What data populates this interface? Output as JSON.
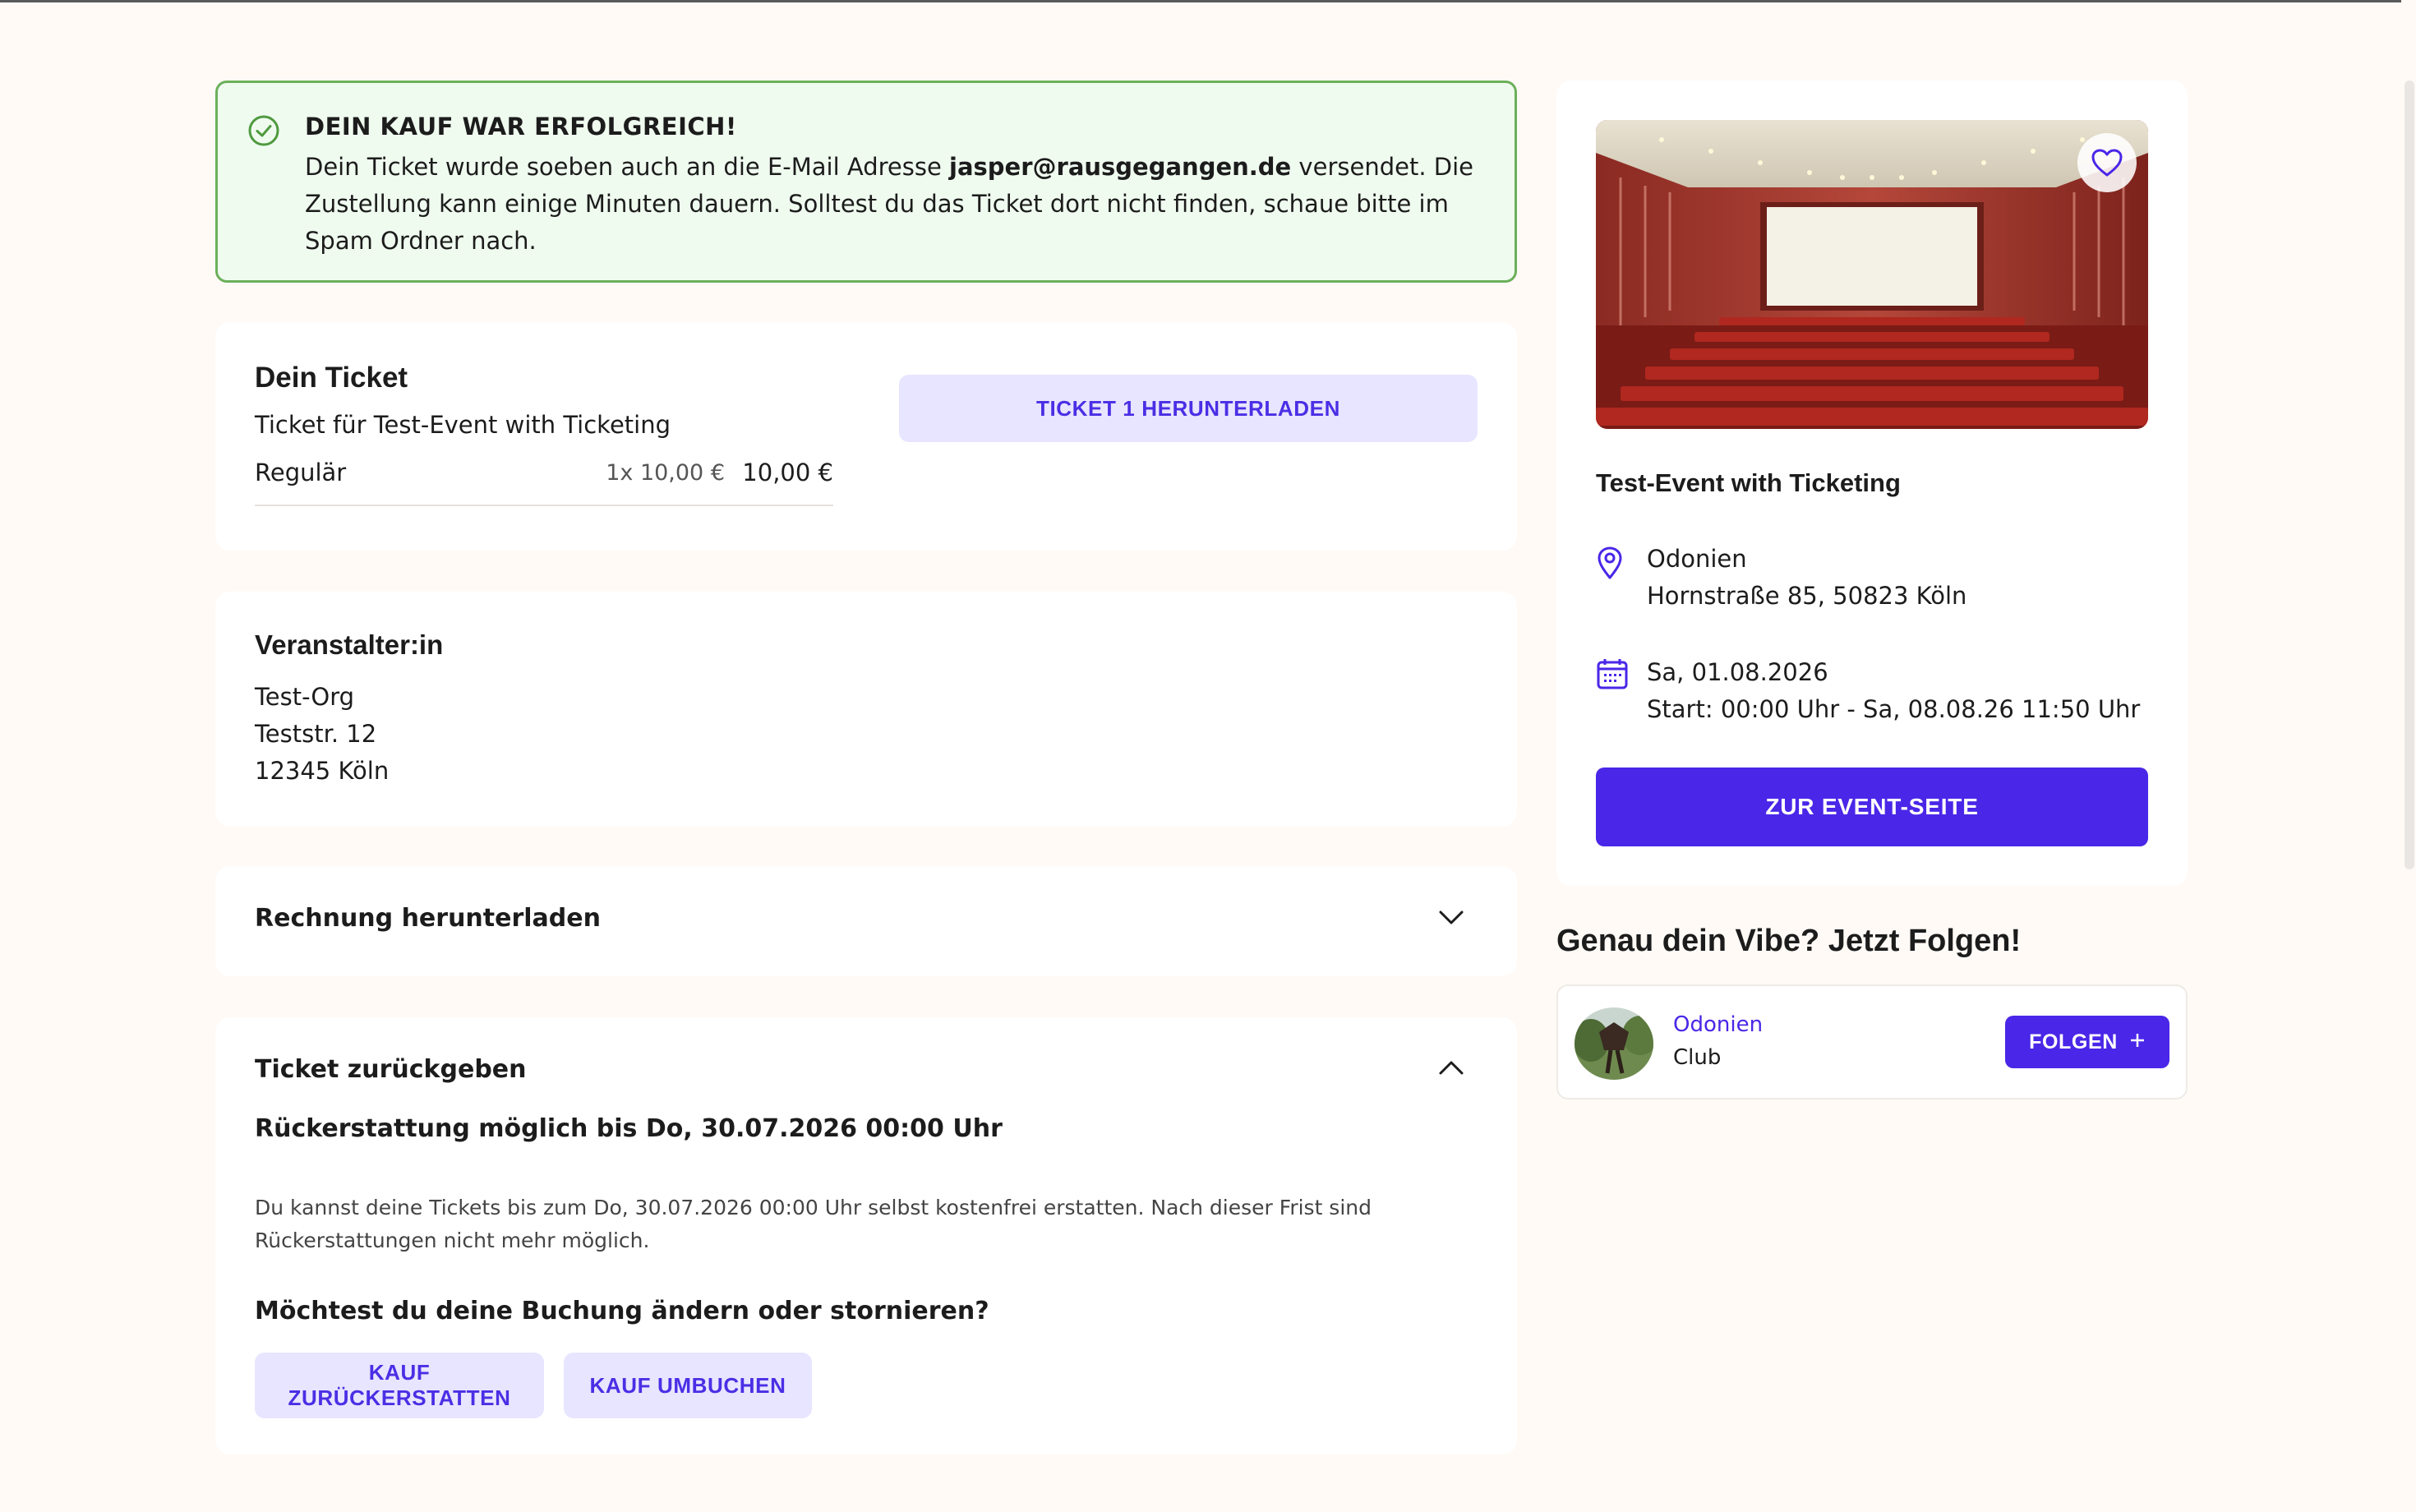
{
  "success": {
    "title": "DEIN KAUF WAR ERFOLGREICH!",
    "message_before": "Dein Ticket wurde soeben auch an die E-Mail Adresse ",
    "email": "jasper@rausgegangen.de",
    "message_after": " versendet. Die Zustellung kann einige Minuten dauern. Solltest du das Ticket dort nicht finden, schaue bitte im Spam Ordner nach."
  },
  "ticket": {
    "heading": "Dein Ticket",
    "subtitle": "Ticket für Test-Event with Ticketing",
    "type": "Regulär",
    "quantity_price": "1x 10,00 €",
    "total": "10,00 €",
    "download_label": "TICKET 1 HERUNTERLADEN"
  },
  "organizer": {
    "heading": "Veranstalter:in",
    "name": "Test-Org",
    "street": "Teststr. 12",
    "city": "12345 Köln"
  },
  "invoice": {
    "label": "Rechnung herunterladen"
  },
  "refund": {
    "label": "Ticket zurückgeben",
    "deadline": "Rückerstattung möglich bis Do, 30.07.2026 00:00 Uhr",
    "info": "Du kannst deine Tickets bis zum Do, 30.07.2026 00:00 Uhr selbst kostenfrei erstatten. Nach dieser Frist sind Rückerstattungen nicht mehr möglich.",
    "question": "Möchtest du deine Buchung ändern oder stornieren?",
    "refund_button": "KAUF ZURÜCKERSTATTEN",
    "rebook_button": "KAUF UMBUCHEN"
  },
  "event": {
    "name": "Test-Event with Ticketing",
    "venue": "Odonien",
    "address": "Hornstraße 85, 50823 Köln",
    "date": "Sa, 01.08.2026",
    "time": "Start: 00:00 Uhr - Sa, 08.08.26 11:50 Uhr",
    "button": "ZUR EVENT-SEITE"
  },
  "follow": {
    "heading": "Genau dein Vibe? Jetzt Folgen!",
    "venue": "Odonien",
    "kind": "Club",
    "button": "FOLGEN"
  },
  "icons": {
    "success": "check-circle-icon",
    "location": "map-pin-icon",
    "calendar": "calendar-icon",
    "favorite": "heart-icon",
    "expand": "chevron-down-icon",
    "collapse": "chevron-up-icon",
    "follow": "plus-icon"
  },
  "colors": {
    "accent": "#4a26e8",
    "accent_soft": "#e7e5ff",
    "success_bg": "#f0fbf0",
    "success_border": "#6bb05b",
    "page_bg": "#fffaf6"
  }
}
